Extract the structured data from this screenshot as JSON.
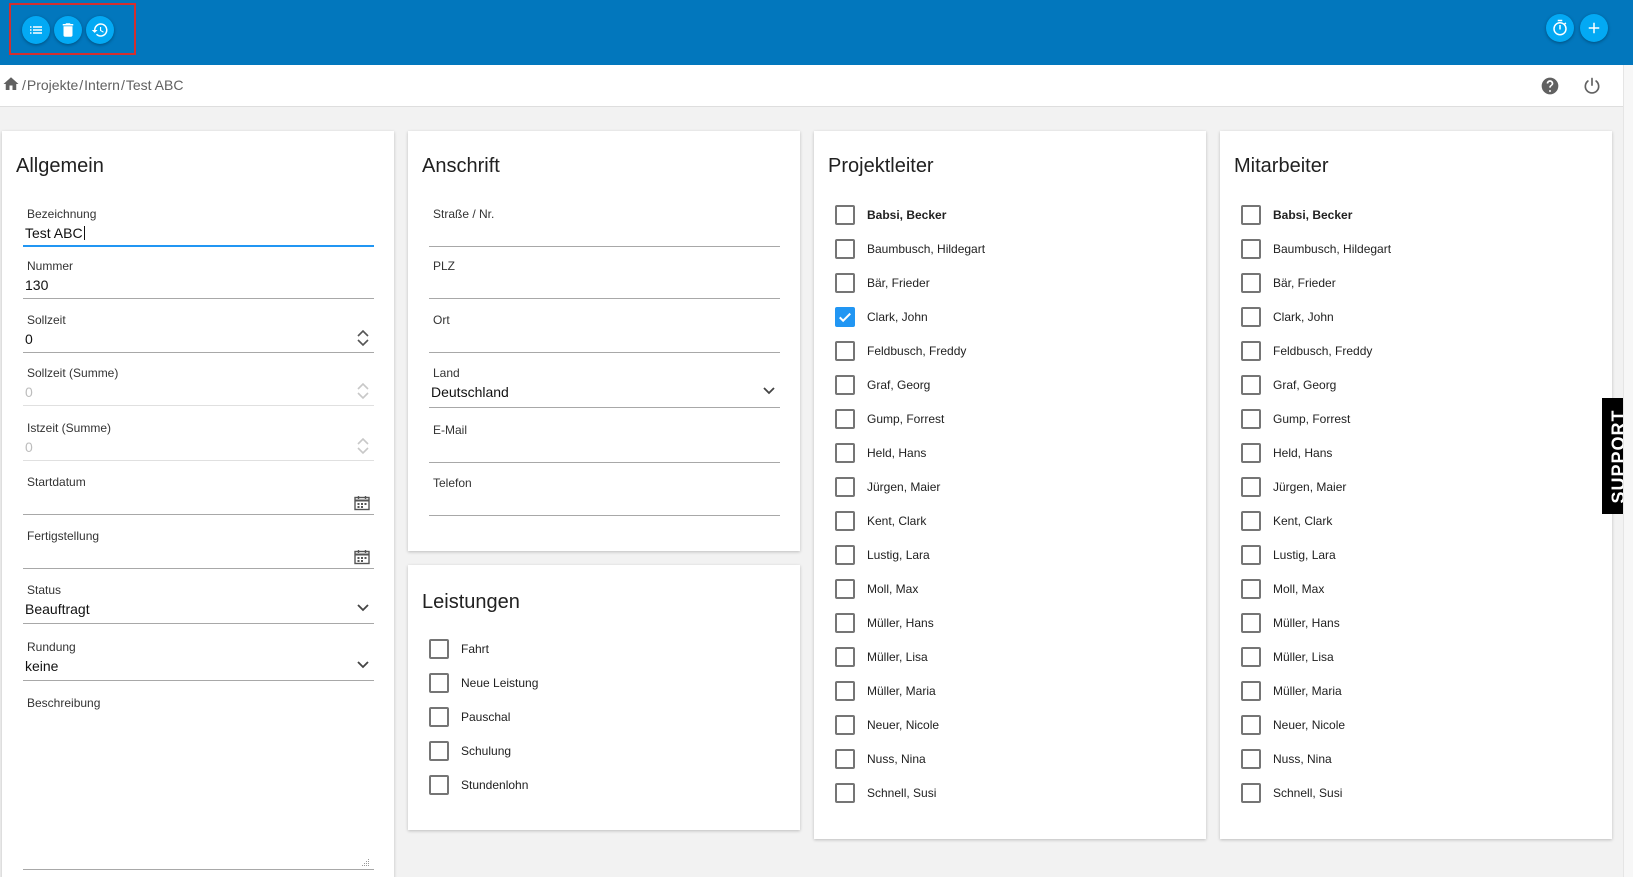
{
  "colors": {
    "topbar": "#0277bd",
    "fab": "#03a9f4",
    "focus": "#2196f3",
    "selection_outline": "#d32f2f"
  },
  "toolbar": {
    "left_icons": [
      "list-icon",
      "trash-icon",
      "history-icon"
    ],
    "right_icons": [
      "stopwatch-icon",
      "plus-icon"
    ]
  },
  "breadcrumb": {
    "separator": "/",
    "items": [
      "Projekte",
      "Intern",
      "Test ABC"
    ]
  },
  "allgemein": {
    "title": "Allgemein",
    "bezeichnung": {
      "label": "Bezeichnung",
      "value": "Test ABC"
    },
    "nummer": {
      "label": "Nummer",
      "value": "130"
    },
    "sollzeit": {
      "label": "Sollzeit",
      "value": "0"
    },
    "sollzeit_summe": {
      "label": "Sollzeit (Summe)",
      "value": "0"
    },
    "istzeit_summe": {
      "label": "Istzeit (Summe)",
      "value": "0"
    },
    "startdatum": {
      "label": "Startdatum",
      "value": ""
    },
    "fertigstellung": {
      "label": "Fertigstellung",
      "value": ""
    },
    "status": {
      "label": "Status",
      "value": "Beauftragt"
    },
    "rundung": {
      "label": "Rundung",
      "value": "keine"
    },
    "beschreibung": {
      "label": "Beschreibung",
      "value": ""
    }
  },
  "anschrift": {
    "title": "Anschrift",
    "strasse": {
      "label": "Straße / Nr.",
      "value": ""
    },
    "plz": {
      "label": "PLZ",
      "value": ""
    },
    "ort": {
      "label": "Ort",
      "value": ""
    },
    "land": {
      "label": "Land",
      "value": "Deutschland"
    },
    "email": {
      "label": "E-Mail",
      "value": ""
    },
    "telefon": {
      "label": "Telefon",
      "value": ""
    }
  },
  "leistungen": {
    "title": "Leistungen",
    "items": [
      {
        "label": "Fahrt",
        "checked": false
      },
      {
        "label": "Neue Leistung",
        "checked": false
      },
      {
        "label": "Pauschal",
        "checked": false
      },
      {
        "label": "Schulung",
        "checked": false
      },
      {
        "label": "Stundenlohn",
        "checked": false
      }
    ]
  },
  "projektleiter": {
    "title": "Projektleiter",
    "items": [
      {
        "label": "Babsi, Becker",
        "checked": false,
        "bold": true
      },
      {
        "label": "Baumbusch, Hildegart",
        "checked": false
      },
      {
        "label": "Bär, Frieder",
        "checked": false
      },
      {
        "label": "Clark, John",
        "checked": true
      },
      {
        "label": "Feldbusch, Freddy",
        "checked": false
      },
      {
        "label": "Graf, Georg",
        "checked": false
      },
      {
        "label": "Gump, Forrest",
        "checked": false
      },
      {
        "label": "Held, Hans",
        "checked": false
      },
      {
        "label": "Jürgen, Maier",
        "checked": false
      },
      {
        "label": "Kent, Clark",
        "checked": false
      },
      {
        "label": "Lustig, Lara",
        "checked": false
      },
      {
        "label": "Moll, Max",
        "checked": false
      },
      {
        "label": "Müller, Hans",
        "checked": false
      },
      {
        "label": "Müller, Lisa",
        "checked": false
      },
      {
        "label": "Müller, Maria",
        "checked": false
      },
      {
        "label": "Neuer, Nicole",
        "checked": false
      },
      {
        "label": "Nuss, Nina",
        "checked": false
      },
      {
        "label": "Schnell, Susi",
        "checked": false
      }
    ]
  },
  "mitarbeiter": {
    "title": "Mitarbeiter",
    "items": [
      {
        "label": "Babsi, Becker",
        "checked": false,
        "bold": true
      },
      {
        "label": "Baumbusch, Hildegart",
        "checked": false
      },
      {
        "label": "Bär, Frieder",
        "checked": false
      },
      {
        "label": "Clark, John",
        "checked": false
      },
      {
        "label": "Feldbusch, Freddy",
        "checked": false
      },
      {
        "label": "Graf, Georg",
        "checked": false
      },
      {
        "label": "Gump, Forrest",
        "checked": false
      },
      {
        "label": "Held, Hans",
        "checked": false
      },
      {
        "label": "Jürgen, Maier",
        "checked": false
      },
      {
        "label": "Kent, Clark",
        "checked": false
      },
      {
        "label": "Lustig, Lara",
        "checked": false
      },
      {
        "label": "Moll, Max",
        "checked": false
      },
      {
        "label": "Müller, Hans",
        "checked": false
      },
      {
        "label": "Müller, Lisa",
        "checked": false
      },
      {
        "label": "Müller, Maria",
        "checked": false
      },
      {
        "label": "Neuer, Nicole",
        "checked": false
      },
      {
        "label": "Nuss, Nina",
        "checked": false
      },
      {
        "label": "Schnell, Susi",
        "checked": false
      }
    ]
  },
  "support": {
    "label": "SUPPORT"
  }
}
